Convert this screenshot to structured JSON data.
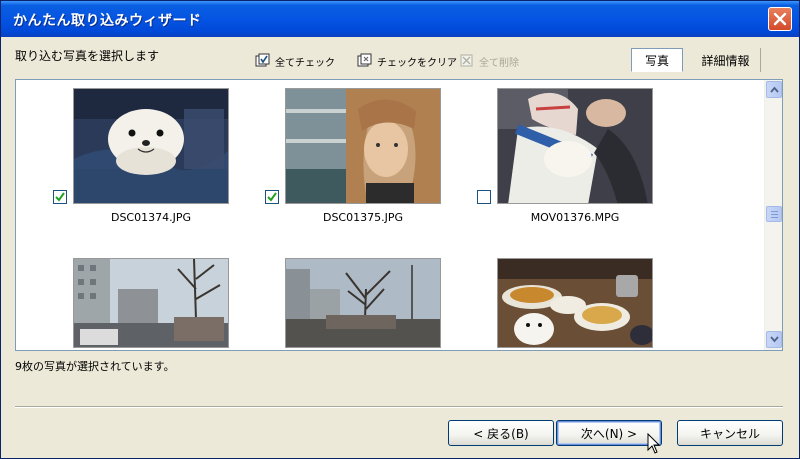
{
  "window": {
    "title": "かんたん取り込みウィザード",
    "close_label": "close"
  },
  "instruction": "取り込む写真を選択します",
  "toolbar": {
    "check_all": "全てチェック",
    "clear_checks": "チェックをクリア",
    "delete_all": "全て削除"
  },
  "view_tabs": {
    "photo": "写真",
    "details": "詳細情報",
    "active": "photo"
  },
  "items": [
    {
      "filename": "DSC01374.JPG",
      "checked": true
    },
    {
      "filename": "DSC01375.JPG",
      "checked": true
    },
    {
      "filename": "MOV01376.MPG",
      "checked": false
    },
    {
      "filename": "",
      "checked": null
    },
    {
      "filename": "",
      "checked": null
    },
    {
      "filename": "",
      "checked": null
    }
  ],
  "status": "9枚の写真が選択されています。",
  "buttons": {
    "back": "< 戻る(B)",
    "next": "次へ(N) >",
    "cancel": "キャンセル"
  },
  "colors": {
    "title_bar": "#0554E3",
    "close_button": "#D34A2A",
    "dialog_bg": "#ECE9D8",
    "border": "#7F9DB9"
  },
  "icons": {
    "check_all": "check-all-icon",
    "clear": "clear-check-icon",
    "delete": "delete-icon"
  }
}
